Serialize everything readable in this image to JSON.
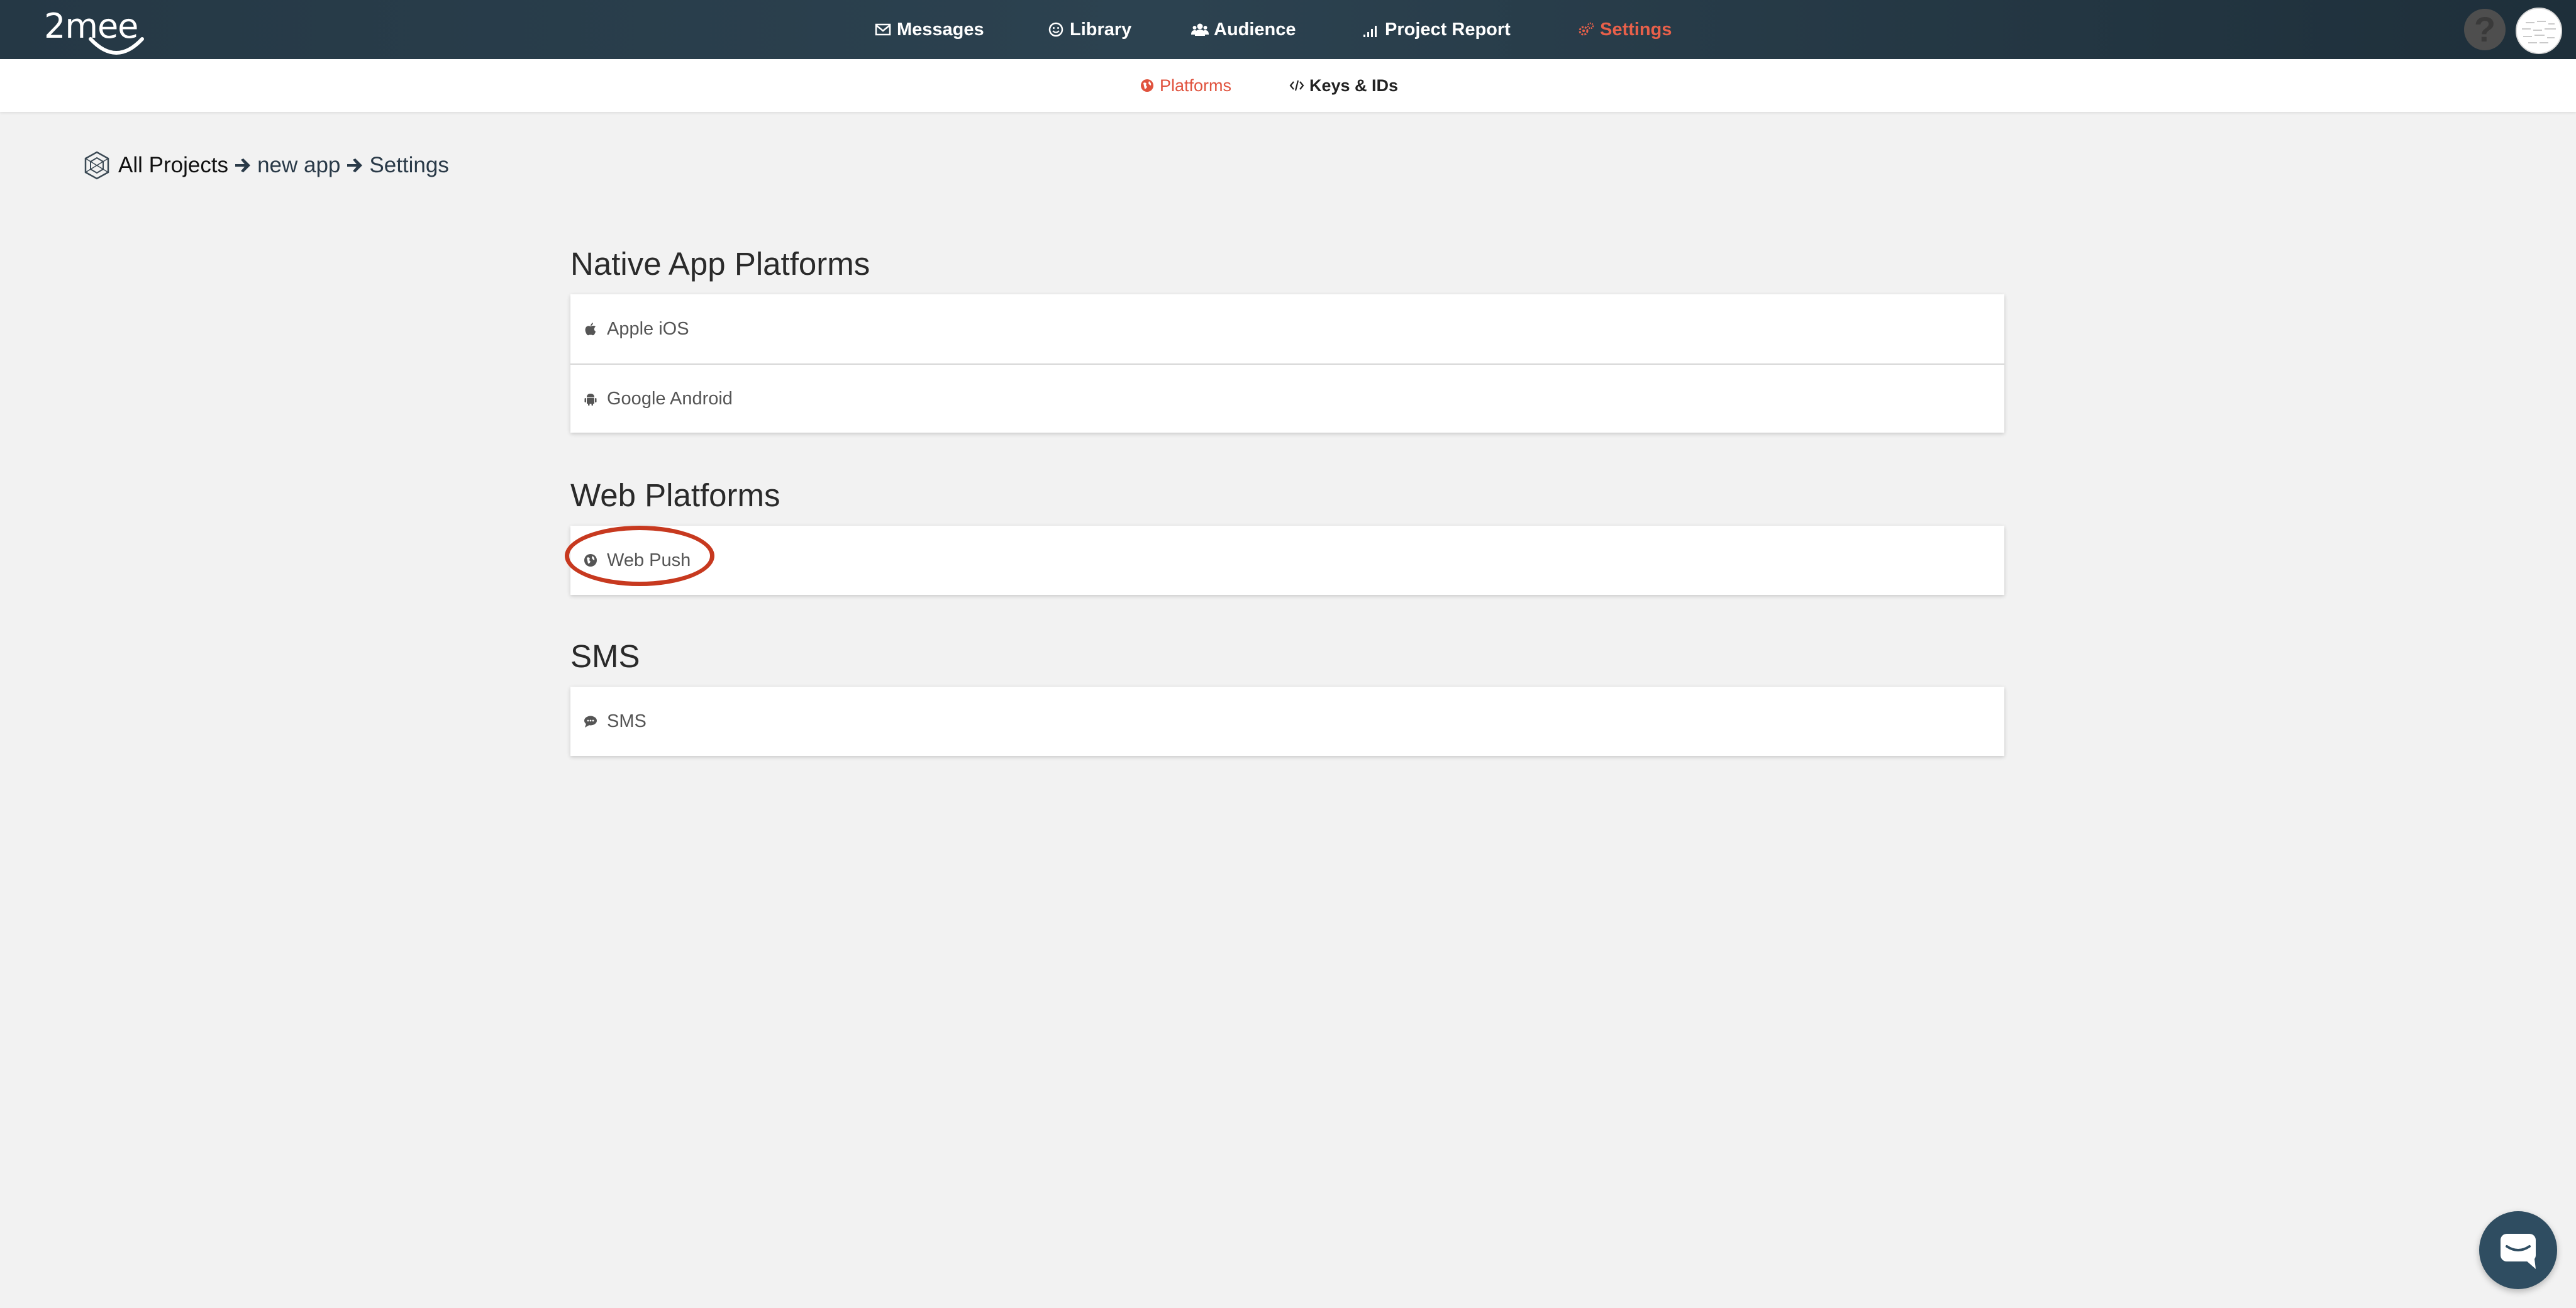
{
  "brand": {
    "logo_text": "2mee"
  },
  "nav": {
    "messages": "Messages",
    "library": "Library",
    "audience": "Audience",
    "project_report": "Project Report",
    "settings": "Settings",
    "active": "Settings",
    "accent_color": "#e8604a"
  },
  "header": {
    "help_label": "?"
  },
  "subnav": {
    "platforms": "Platforms",
    "keys_ids": "Keys & IDs",
    "active": "Platforms"
  },
  "breadcrumb": {
    "root": "All Projects",
    "project": "new app",
    "page": "Settings"
  },
  "sections": {
    "native": {
      "title": "Native App Platforms",
      "items": [
        {
          "label": "Apple iOS",
          "icon": "apple-icon"
        },
        {
          "label": "Google Android",
          "icon": "android-icon"
        }
      ]
    },
    "web": {
      "title": "Web Platforms",
      "items": [
        {
          "label": "Web Push",
          "icon": "globe-icon"
        }
      ]
    },
    "sms": {
      "title": "SMS",
      "items": [
        {
          "label": "SMS",
          "icon": "comment-icon"
        }
      ]
    }
  },
  "annotation": {
    "highlight_color": "#c7391f",
    "highlighted_item": "Web Push"
  }
}
